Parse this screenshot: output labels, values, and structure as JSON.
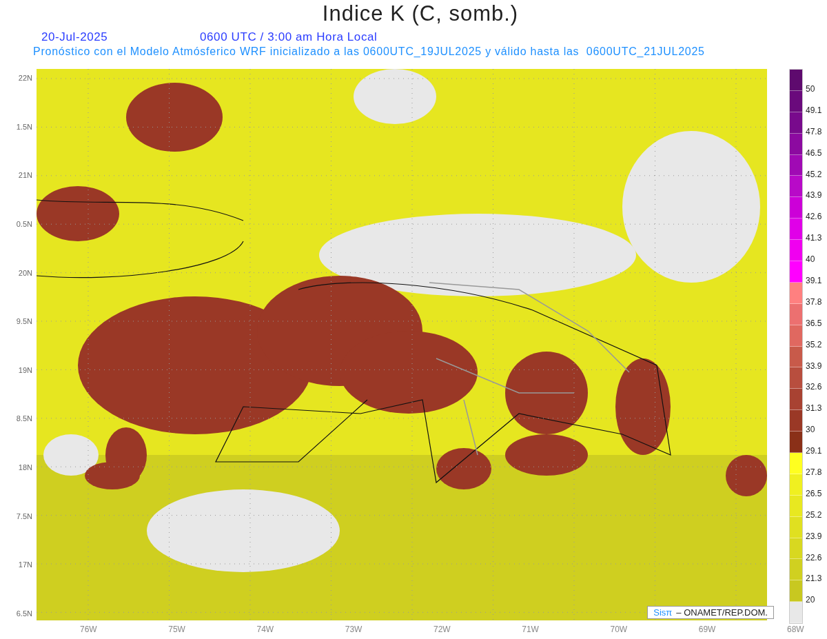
{
  "title": "Indice K (C, somb.)",
  "date": "20-Jul-2025",
  "time": "0600 UTC / 3:00 am Hora Local",
  "subtitle": "Pronóstico con el Modelo Atmósferico WRF inicializado a las 0600UTC_19JUL2025 y válido hasta las  0600UTC_21JUL2025",
  "y_axis": [
    "22N",
    "1.5N",
    "21N",
    "0.5N",
    "20N",
    "9.5N",
    "19N",
    "8.5N",
    "18N",
    "7.5N",
    "17N",
    "6.5N"
  ],
  "x_axis": [
    "76W",
    "75W",
    "74W",
    "73W",
    "72W",
    "71W",
    "70W",
    "69W",
    "68W"
  ],
  "credit": {
    "logo": "Sisπ",
    "text": "– ONAMET/REP.DOM."
  },
  "colorbar": {
    "labels": [
      "50",
      "49.1",
      "47.8",
      "46.5",
      "45.2",
      "43.9",
      "42.6",
      "41.3",
      "40",
      "39.1",
      "37.8",
      "36.5",
      "35.2",
      "33.9",
      "32.6",
      "31.3",
      "30",
      "29.1",
      "27.8",
      "26.5",
      "25.2",
      "23.9",
      "22.6",
      "21.3",
      "20"
    ],
    "segments": [
      {
        "color": "#5e0a6e"
      },
      {
        "color": "#6a0a7c"
      },
      {
        "color": "#780a8c"
      },
      {
        "color": "#8c0aa0"
      },
      {
        "color": "#a00ab4"
      },
      {
        "color": "#b80ac8"
      },
      {
        "color": "#cc00d8"
      },
      {
        "color": "#e000e8"
      },
      {
        "color": "#f000f0"
      },
      {
        "color": "#ff00ff"
      },
      {
        "color": "#ff8080"
      },
      {
        "color": "#ec7070"
      },
      {
        "color": "#e06860"
      },
      {
        "color": "#c85a4a"
      },
      {
        "color": "#b84e3e"
      },
      {
        "color": "#a84232"
      },
      {
        "color": "#9a3826"
      },
      {
        "color": "#8a3018"
      },
      {
        "color": "#ffff20"
      },
      {
        "color": "#f0f020"
      },
      {
        "color": "#e8e820"
      },
      {
        "color": "#e0e020"
      },
      {
        "color": "#d8d820"
      },
      {
        "color": "#d0d020"
      },
      {
        "color": "#c8c820"
      },
      {
        "color": "#e8e8e8"
      }
    ]
  }
}
